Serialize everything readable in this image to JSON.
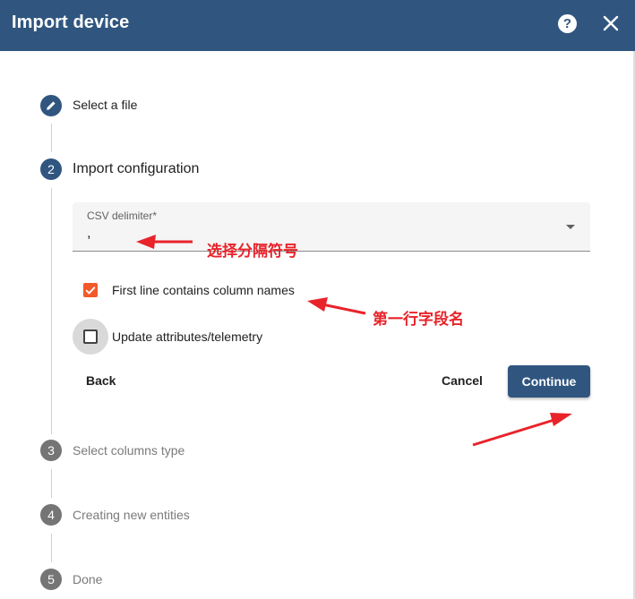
{
  "dialog": {
    "title": "Import device",
    "help_icon": "question-circle-icon",
    "close_icon": "close-icon"
  },
  "steps": [
    {
      "number": "",
      "label": "Select a file",
      "state": "done",
      "icon": "pencil-icon"
    },
    {
      "number": "2",
      "label": "Import configuration",
      "state": "active"
    },
    {
      "number": "3",
      "label": "Select columns type",
      "state": "pending"
    },
    {
      "number": "4",
      "label": "Creating new entities",
      "state": "pending"
    },
    {
      "number": "5",
      "label": "Done",
      "state": "pending"
    }
  ],
  "config": {
    "delimiter_label": "CSV delimiter*",
    "delimiter_value": ",",
    "first_line_label": "First line contains column names",
    "first_line_checked": true,
    "update_label": "Update attributes/telemetry",
    "update_checked": false
  },
  "buttons": {
    "back": "Back",
    "cancel": "Cancel",
    "continue": "Continue"
  },
  "annotations": {
    "delimiter_note": "选择分隔符号",
    "first_line_note": "第一行字段名"
  },
  "colors": {
    "primary": "#305680",
    "checkbox_accent": "#f15a29",
    "annotation_red": "#e8232a"
  }
}
